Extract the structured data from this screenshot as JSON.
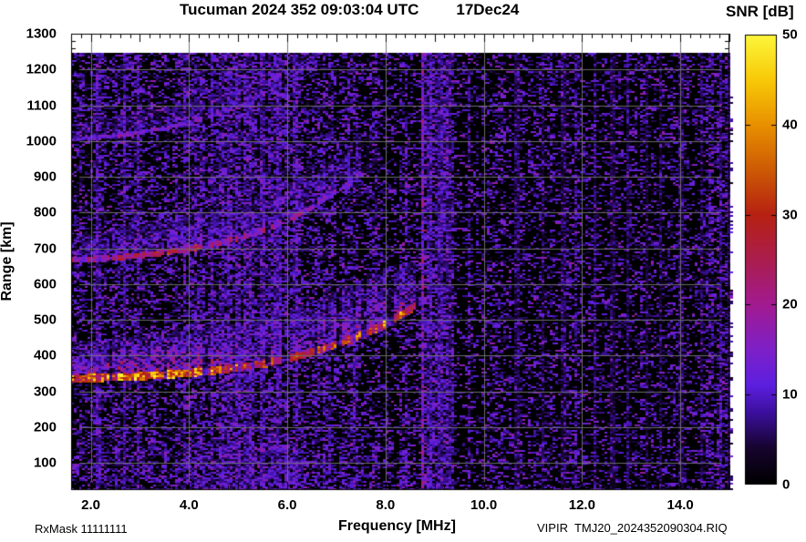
{
  "title": {
    "station_time": "Tucuman 2024 352 09:03:04 UTC",
    "date": "17Dec24"
  },
  "colorbar": {
    "title": "SNR [dB]",
    "tick_labels": [
      "0",
      "10",
      "20",
      "30",
      "40",
      "50"
    ],
    "tick_values": [
      0,
      10,
      20,
      30,
      40,
      50
    ],
    "inner_tick_values": [
      10,
      20,
      30,
      40
    ],
    "range": [
      0,
      50
    ]
  },
  "axes": {
    "x_label": "Frequency [MHz]",
    "y_label": "Range [km]",
    "x_ticks": [
      {
        "v": 2,
        "label": "2.0"
      },
      {
        "v": 4,
        "label": "4.0"
      },
      {
        "v": 6,
        "label": "6.0"
      },
      {
        "v": 8,
        "label": "8.0"
      },
      {
        "v": 10,
        "label": "10.0"
      },
      {
        "v": 12,
        "label": "12.0"
      },
      {
        "v": 14,
        "label": "14.0"
      }
    ],
    "y_ticks": [
      {
        "v": 100,
        "label": "100"
      },
      {
        "v": 200,
        "label": "200"
      },
      {
        "v": 300,
        "label": "300"
      },
      {
        "v": 400,
        "label": "400"
      },
      {
        "v": 500,
        "label": "500"
      },
      {
        "v": 600,
        "label": "600"
      },
      {
        "v": 700,
        "label": "700"
      },
      {
        "v": 800,
        "label": "800"
      },
      {
        "v": 900,
        "label": "900"
      },
      {
        "v": 1000,
        "label": "1000"
      },
      {
        "v": 1100,
        "label": "1100"
      },
      {
        "v": 1200,
        "label": "1200"
      },
      {
        "v": 1300,
        "label": "1300"
      }
    ]
  },
  "footer": {
    "rx_mask": "RxMask 11111111",
    "file_id": "VIPIR  TMJ20_2024352090304.RIQ"
  },
  "chart_data": {
    "type": "heatmap",
    "title": "Tucuman 2024 352 09:03:04 UTC 17Dec24",
    "xlabel": "Frequency [MHz]",
    "ylabel": "Range [km]",
    "zlabel": "SNR [dB]",
    "xlim": [
      1.6,
      15.0
    ],
    "ylim": [
      24,
      1300
    ],
    "zlim": [
      0,
      50
    ],
    "x_major_mhz": 1.0,
    "x_minor_mhz": 0.2,
    "x_grid_mhz": [
      2,
      4,
      6,
      8,
      10,
      12,
      14
    ],
    "y_major_km": 100,
    "y_minor_km": 20,
    "y_grid_km": [
      100,
      200,
      300,
      400,
      500,
      600,
      700,
      800,
      900,
      1000,
      1100,
      1200
    ],
    "data_top_km": 1247,
    "seed": 7,
    "colormap": [
      [
        0.0,
        "#000000"
      ],
      [
        0.08,
        "#16042e"
      ],
      [
        0.16,
        "#3c0f9e"
      ],
      [
        0.22,
        "#5c1fe0"
      ],
      [
        0.3,
        "#7e20c8"
      ],
      [
        0.4,
        "#a21a90"
      ],
      [
        0.5,
        "#ab1d4e"
      ],
      [
        0.6,
        "#b62112"
      ],
      [
        0.7,
        "#cd5a04"
      ],
      [
        0.8,
        "#e89000"
      ],
      [
        0.9,
        "#f8c908"
      ],
      [
        1.0,
        "#fcf63a"
      ]
    ],
    "noise": {
      "split_mhz": 8.6,
      "left_density": 0.42,
      "right_density": 0.3,
      "low_range_boost": 1.25,
      "stripe_zones": [
        [
          3.8,
          6.35,
          1.5
        ],
        [
          8.62,
          9.4,
          2.0
        ],
        [
          14.6,
          15.0,
          1.5
        ]
      ]
    },
    "rfi_lines": [
      [
        8.76,
        24
      ],
      [
        8.94,
        12
      ],
      [
        9.12,
        10
      ],
      [
        9.3,
        8
      ],
      [
        10.68,
        8
      ],
      [
        11.2,
        7
      ],
      [
        11.62,
        8
      ],
      [
        12.28,
        8
      ],
      [
        12.62,
        7
      ],
      [
        12.95,
        10
      ],
      [
        13.3,
        7
      ],
      [
        13.62,
        8
      ],
      [
        14.02,
        8
      ],
      [
        14.45,
        7
      ],
      [
        14.82,
        11
      ],
      [
        14.97,
        9
      ]
    ],
    "echo_traces": {
      "critical_frequency_mhz": 8.75,
      "min_virtual_height_km": 325,
      "h1_points": [
        [
          1.6,
          324
        ],
        [
          2.0,
          326
        ],
        [
          2.5,
          328
        ],
        [
          3.0,
          331
        ],
        [
          3.5,
          335
        ],
        [
          4.0,
          340
        ],
        [
          4.5,
          347
        ],
        [
          5.0,
          355
        ],
        [
          5.5,
          366
        ],
        [
          6.0,
          380
        ],
        [
          6.5,
          398
        ],
        [
          7.0,
          420
        ],
        [
          7.5,
          446
        ],
        [
          8.0,
          476
        ],
        [
          8.3,
          500
        ],
        [
          8.55,
          522
        ],
        [
          8.75,
          545
        ]
      ],
      "hops": [
        {
          "name": "F-trace 1st hop",
          "scale": 1.0,
          "offset": 0,
          "fmax": 8.75,
          "fade_width": 0.3,
          "core_thickness_km": 22,
          "core_snr": [
            [
              1.6,
              36
            ],
            [
              2.2,
              39
            ],
            [
              3.0,
              40
            ],
            [
              4.0,
              38
            ],
            [
              4.8,
              35
            ],
            [
              5.5,
              31
            ],
            [
              6.2,
              30
            ],
            [
              7.0,
              32
            ],
            [
              7.6,
              34
            ],
            [
              8.2,
              33
            ],
            [
              8.75,
              27
            ]
          ],
          "spread_km": [
            [
              1.6,
              90
            ],
            [
              3.0,
              105
            ],
            [
              5.0,
              115
            ],
            [
              6.0,
              125
            ],
            [
              7.0,
              140
            ],
            [
              8.0,
              150
            ],
            [
              8.75,
              110
            ]
          ]
        },
        {
          "name": "2nd hop multiple",
          "scale": 2.0,
          "offset": 10,
          "fmax": 7.9,
          "fade_width": 0.5,
          "core_thickness_km": 16,
          "core_snr": [
            [
              1.6,
              20
            ],
            [
              2.5,
              23
            ],
            [
              3.5,
              24
            ],
            [
              4.5,
              23
            ],
            [
              5.5,
              21
            ],
            [
              6.5,
              19
            ],
            [
              7.3,
              15
            ],
            [
              7.9,
              9
            ]
          ],
          "spread_km": [
            [
              1.6,
              60
            ],
            [
              3.0,
              80
            ],
            [
              5.0,
              95
            ],
            [
              6.5,
              95
            ],
            [
              7.9,
              80
            ]
          ]
        },
        {
          "name": "3rd hop multiple",
          "scale": 3.0,
          "offset": 25,
          "fmax": 7.0,
          "fade_width": 0.6,
          "core_thickness_km": 12,
          "core_snr": [
            [
              1.6,
              13
            ],
            [
              2.5,
              15
            ],
            [
              4.0,
              14
            ],
            [
              5.5,
              13
            ],
            [
              6.2,
              12
            ],
            [
              7.0,
              8
            ]
          ],
          "spread_km": [
            [
              1.6,
              40
            ],
            [
              4.0,
              55
            ],
            [
              7.0,
              55
            ]
          ]
        }
      ],
      "gaps": [
        {
          "f": 4.32,
          "w": 0.05,
          "g": 0.25
        },
        {
          "f": 4.92,
          "w": 0.04,
          "g": 0.3
        },
        {
          "f": 5.3,
          "w": 0.04,
          "g": 0.35
        },
        {
          "f": 5.62,
          "w": 0.05,
          "g": 0.2
        },
        {
          "f": 5.97,
          "w": 0.06,
          "g": 0.15
        },
        {
          "f": 6.58,
          "w": 0.05,
          "g": 0.2
        },
        {
          "f": 7.07,
          "w": 0.05,
          "g": 0.25
        },
        {
          "f": 7.56,
          "w": 0.04,
          "g": 0.3
        },
        {
          "f": 8.08,
          "w": 0.04,
          "g": 0.3
        }
      ]
    },
    "e_region_streak": {
      "f0": 5.3,
      "r0": 45,
      "f1": 6.4,
      "r1": 110,
      "amp": 12,
      "half_width_km": 9
    },
    "blobs": [
      {
        "f": 1.68,
        "df": 0.06,
        "r": 85,
        "dr": 14,
        "amp": 16
      }
    ]
  }
}
